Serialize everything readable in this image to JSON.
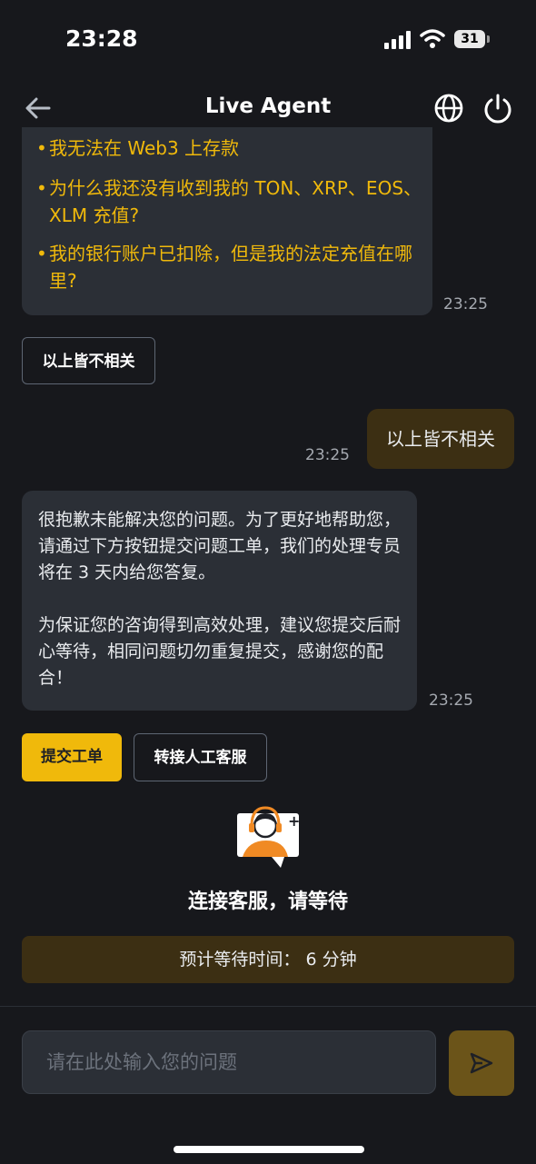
{
  "status": {
    "time": "23:28",
    "battery": "31"
  },
  "header": {
    "title": "Live Agent"
  },
  "faq": {
    "items": [
      "我无法在 Web3 上存款",
      "为什么我还没有收到我的 TON、XRP、EOS、XLM 充值?",
      "我的银行账户已扣除，但是我的法定充值在哪里?"
    ],
    "timestamp": "23:25"
  },
  "option_button": "以上皆不相关",
  "user_message": {
    "text": "以上皆不相关",
    "timestamp": "23:25"
  },
  "agent_message": {
    "paragraph1": "很抱歉未能解决您的问题。为了更好地帮助您，请通过下方按钮提交问题工单，我们的处理专员将在 3 天内给您答复。",
    "paragraph2": "为保证您的咨询得到高效处理，建议您提交后耐心等待，相同问题切勿重复提交，感谢您的配合！",
    "timestamp": "23:25"
  },
  "actions": {
    "submit_ticket": "提交工单",
    "transfer_agent": "转接人工客服"
  },
  "waiting": {
    "title": "连接客服，请等待",
    "estimate": "预计等待时间： 6 分钟"
  },
  "composer": {
    "placeholder": "请在此处输入您的问题"
  },
  "colors": {
    "accent": "#f0b90b",
    "bubble": "#2b2f36",
    "user_bubble": "#3c2f13",
    "background": "#17181c"
  },
  "icons": [
    "back-arrow-icon",
    "globe-icon",
    "power-icon",
    "send-icon",
    "agent-headset-icon"
  ]
}
